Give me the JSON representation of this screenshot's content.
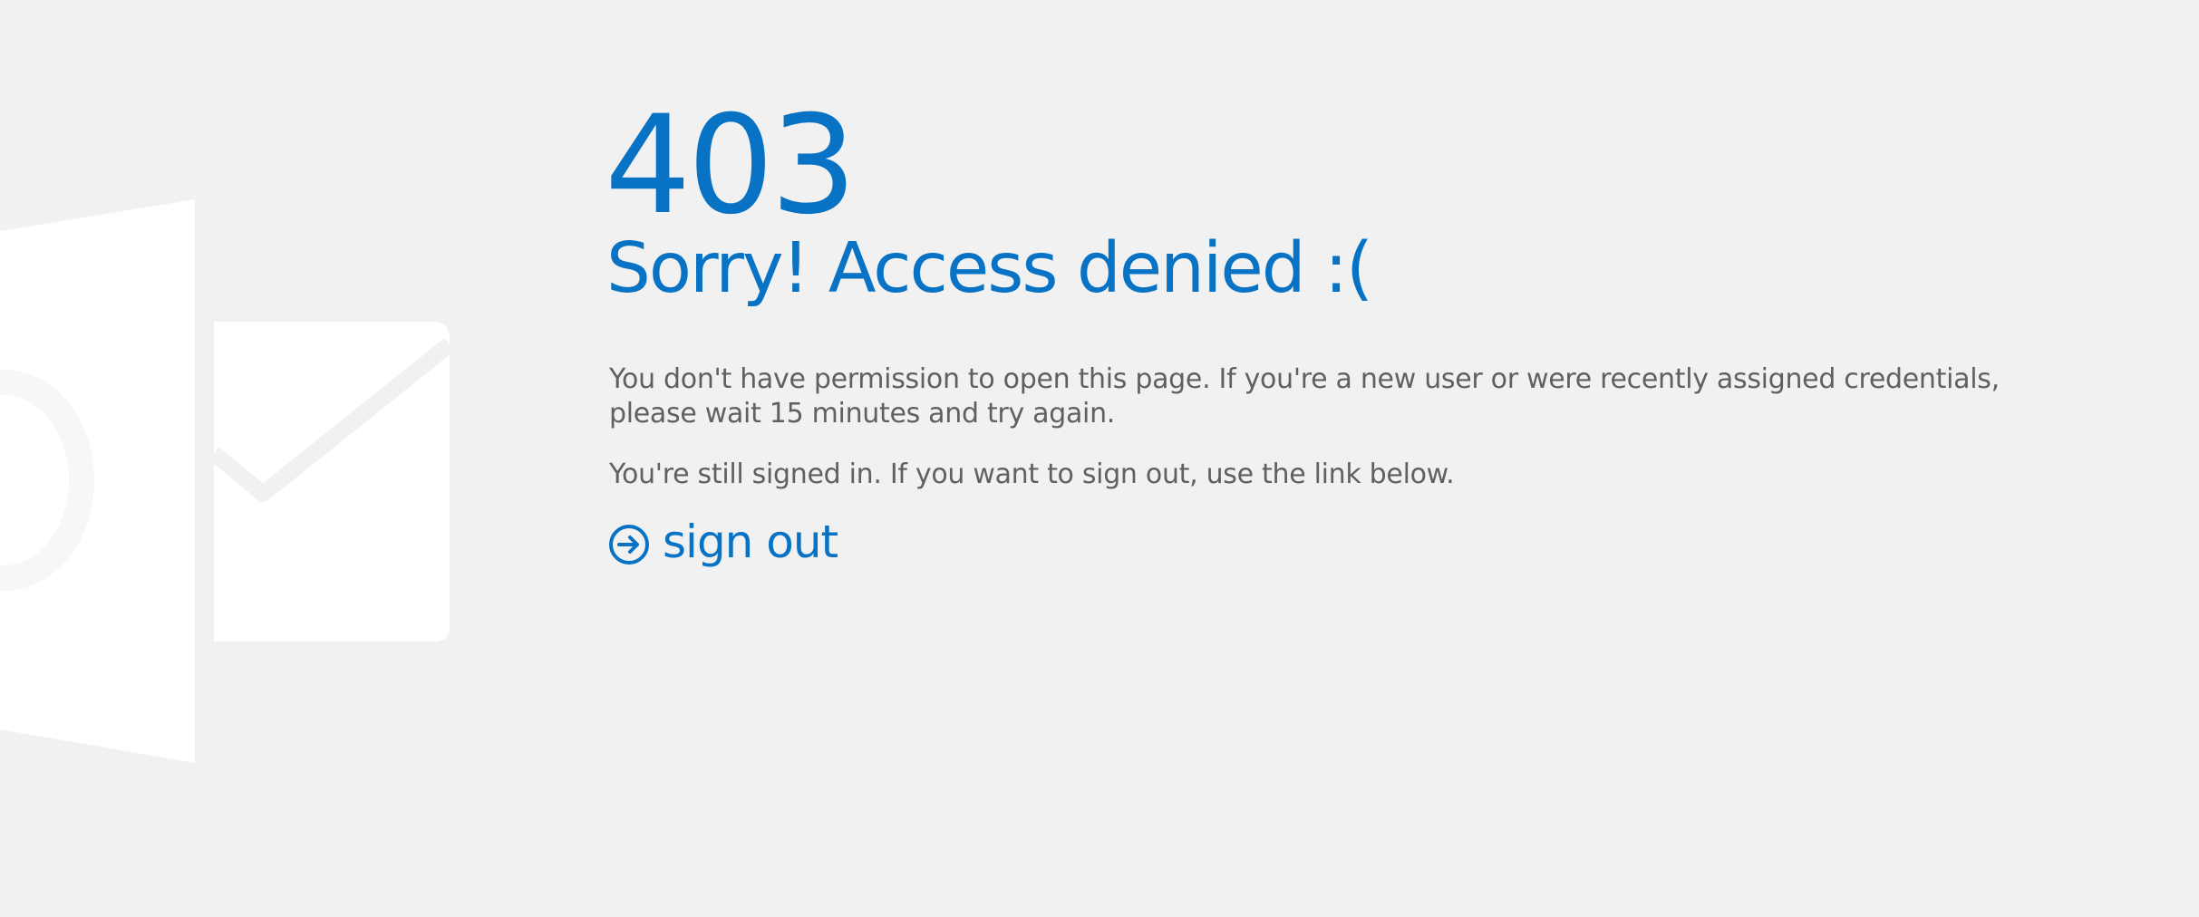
{
  "error": {
    "code": "403",
    "title": "Sorry! Access denied :("
  },
  "messages": {
    "permission": "You don't have permission to open this page. If you're a new user or were recently assigned credentials, please wait 15 minutes and try again.",
    "signed_in": "You're still signed in. If you want to sign out, use the link below."
  },
  "signout": {
    "label": "sign out",
    "icon": "arrow-circle-right-icon"
  },
  "colors": {
    "accent": "#0872c4",
    "text": "#606060",
    "background": "#f1f1f1",
    "watermark": "#ffffff"
  },
  "watermark": {
    "icon": "outlook-logo-icon"
  }
}
